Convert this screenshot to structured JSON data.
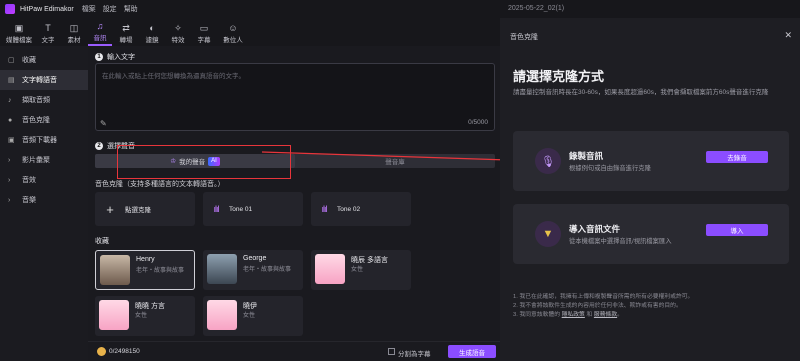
{
  "titlebar": {
    "app_name": "HitPaw Edimakor",
    "menu": [
      "檔案",
      "設定",
      "幫助"
    ],
    "project": "2025-05-22_02(1)"
  },
  "toolbar": [
    {
      "label": "媒體檔案",
      "icon": "media-icon"
    },
    {
      "label": "文字",
      "icon": "text-icon"
    },
    {
      "label": "素材",
      "icon": "asset-icon"
    },
    {
      "label": "音訊",
      "icon": "music-icon",
      "active": true
    },
    {
      "label": "轉場",
      "icon": "transition-icon"
    },
    {
      "label": "濾鏡",
      "icon": "filter-icon"
    },
    {
      "label": "特效",
      "icon": "effect-icon"
    },
    {
      "label": "字幕",
      "icon": "subtitle-icon"
    },
    {
      "label": "數位人",
      "icon": "avatar-icon"
    }
  ],
  "sidebar": {
    "items": [
      "收藏",
      "文字轉語音",
      "擷取音頻",
      "音色克隆",
      "音頻下載器",
      "影片彙聚",
      "音效",
      "音樂"
    ]
  },
  "main": {
    "section1_label": "輸入文字",
    "text_placeholder": "在此輸入或貼上任何您想轉換為逼真語音的文字。",
    "char_count": "0/5000",
    "section2_label": "選擇聲音",
    "tab_my_voice": "我的聲音",
    "ai_badge": "AI",
    "tab_voice_library": "聲音庫",
    "clone_label": "音色克隆（支持多種語言的文本轉語音。）",
    "paste_clone": "點選克隆",
    "tone1": "Tone 01",
    "tone2": "Tone 02",
    "favorites_label": "收藏",
    "people": [
      {
        "name": "Henry",
        "desc": "老年・故事與故事"
      },
      {
        "name": "George",
        "desc": "老年・故事與故事"
      },
      {
        "name": "曉辰 多語言",
        "desc": "女性"
      },
      {
        "name": "曉曉 方言",
        "desc": "女性"
      },
      {
        "name": "曉伊",
        "desc": "女性"
      }
    ]
  },
  "bottom": {
    "credits": "0/2498150",
    "split_label": "分割為字幕",
    "generate": "生成語音"
  },
  "panel": {
    "title": "音色克隆",
    "heading": "請選擇克隆方式",
    "subtitle": "請盡量控制音訊時長在30-60s，如果長度超過60s，我們會擷取檔案前方60s聲音進行克隆",
    "option1": {
      "title": "錄製音訊",
      "desc": "根據例句或自由錄音進行克隆",
      "button": "去錄音"
    },
    "option2": {
      "title": "導入音訊文件",
      "desc": "從本機檔案中選擇音訊/視訊檔案匯入",
      "button": "導入"
    },
    "note1": "1. 我已在此確認，我擁有上傳和複製聲音所需的所有必要權利或許可。",
    "note2": "2. 我不會將該軟件生成的內容用於任何非法、欺詐或有害的目的。",
    "note3_prefix": "3. 我同意該軟體的",
    "note3_link1": "隱私政策",
    "note3_and": "和",
    "note3_link2": "服務條款",
    "note3_suffix": "。"
  },
  "colors": {
    "accent": "#8b4dff",
    "highlight_box": "#e8353b",
    "panel_bg": "#1e1e23"
  }
}
